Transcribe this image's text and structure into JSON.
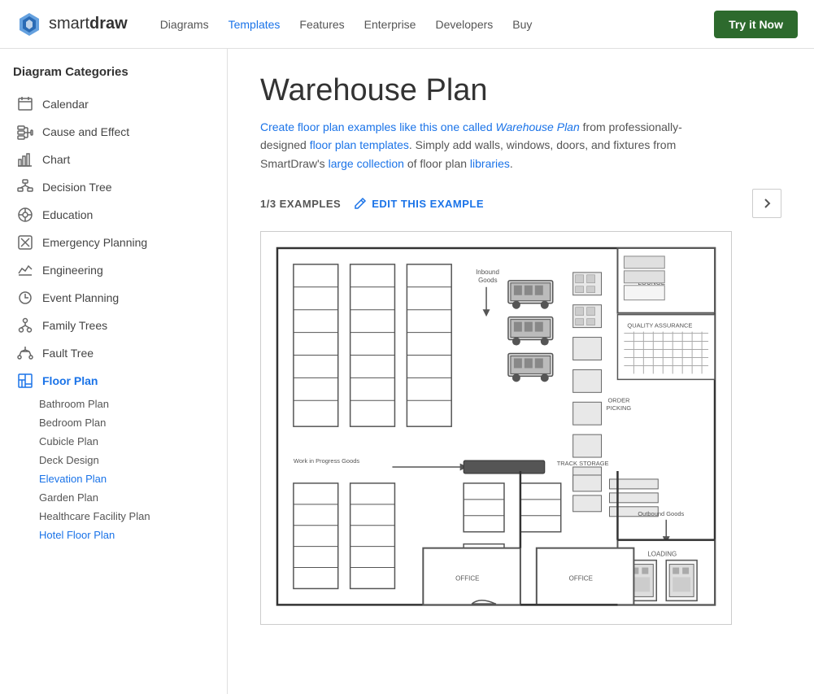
{
  "nav": {
    "logo_text_light": "smart",
    "logo_text_bold": "draw",
    "links": [
      {
        "label": "Diagrams",
        "active": false
      },
      {
        "label": "Templates",
        "active": true
      },
      {
        "label": "Features",
        "active": false
      },
      {
        "label": "Enterprise",
        "active": false
      },
      {
        "label": "Developers",
        "active": false
      },
      {
        "label": "Buy",
        "active": false
      }
    ],
    "cta": "Try it Now"
  },
  "sidebar": {
    "heading": "Diagram Categories",
    "items": [
      {
        "label": "Calendar",
        "icon": "calendar"
      },
      {
        "label": "Cause and Effect",
        "icon": "cause-effect"
      },
      {
        "label": "Chart",
        "icon": "chart"
      },
      {
        "label": "Decision Tree",
        "icon": "decision-tree"
      },
      {
        "label": "Education",
        "icon": "education"
      },
      {
        "label": "Emergency Planning",
        "icon": "emergency"
      },
      {
        "label": "Engineering",
        "icon": "engineering"
      },
      {
        "label": "Event Planning",
        "icon": "event"
      },
      {
        "label": "Family Trees",
        "icon": "family"
      },
      {
        "label": "Fault Tree",
        "icon": "fault"
      },
      {
        "label": "Floor Plan",
        "icon": "floor-plan",
        "active": true
      }
    ],
    "sub_items": [
      {
        "label": "Bathroom Plan",
        "active": false
      },
      {
        "label": "Bedroom Plan",
        "active": false
      },
      {
        "label": "Cubicle Plan",
        "active": false
      },
      {
        "label": "Deck Design",
        "active": false
      },
      {
        "label": "Elevation Plan",
        "active": false
      },
      {
        "label": "Garden Plan",
        "active": false
      },
      {
        "label": "Healthcare Facility Plan",
        "active": false
      },
      {
        "label": "Hotel Floor Plan",
        "active": false
      }
    ]
  },
  "main": {
    "title": "Warehouse Plan",
    "description_parts": [
      "Create floor plan examples like this one called ",
      "Warehouse Plan",
      " from professionally-designed floor plan templates. Simply add walls, windows, doors, and fixtures from SmartDraw's large collection of floor plan libraries."
    ],
    "example_count": "1/3 EXAMPLES",
    "edit_label": "EDIT THIS EXAMPLE"
  }
}
